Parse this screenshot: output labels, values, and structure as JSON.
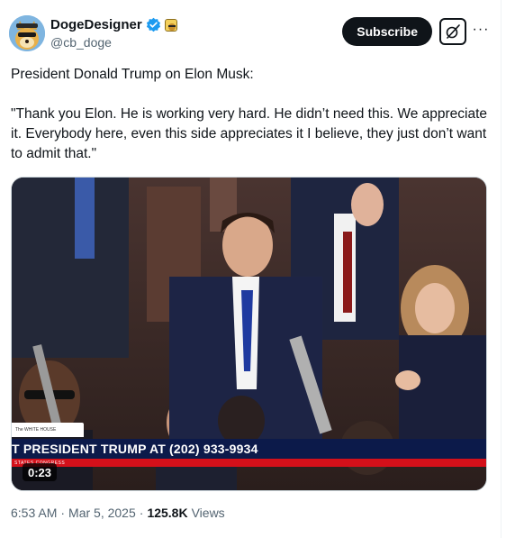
{
  "author": {
    "display_name": "DogeDesigner",
    "handle": "@cb_doge",
    "avatar_icon": "doge-avatar-icon",
    "verified_icon": "verified-badge-icon",
    "affiliate_icon": "affiliate-badge-icon"
  },
  "actions": {
    "subscribe_label": "Subscribe",
    "grok_icon": "grok-icon",
    "more_icon": "more-icon",
    "more_glyph": "···"
  },
  "tweet": {
    "paragraph_1": "President Donald Trump on Elon Musk:",
    "paragraph_2": "\"Thank you Elon. He is working very hard. He didn’t need this. We appreciate it. Everybody here, even this side appreciates it I believe, they just don’t want to admit that.\""
  },
  "media": {
    "ticker_text": "T PRESIDENT TRUMP AT (202) 933-9934",
    "ticker_sub_text": "STATES CONGRESS",
    "brand_tag": "The WHITE HOUSE",
    "duration": "0:23"
  },
  "meta": {
    "time": "6:53 AM",
    "separator": "·",
    "date": "Mar 5, 2025",
    "views_count": "125.8K",
    "views_label": "Views"
  },
  "colors": {
    "brand_verified": "#1d9bf0",
    "text_primary": "#0f1419",
    "text_secondary": "#536471",
    "ticker_blue": "#0c1a4a",
    "ticker_red": "#d4101a"
  }
}
